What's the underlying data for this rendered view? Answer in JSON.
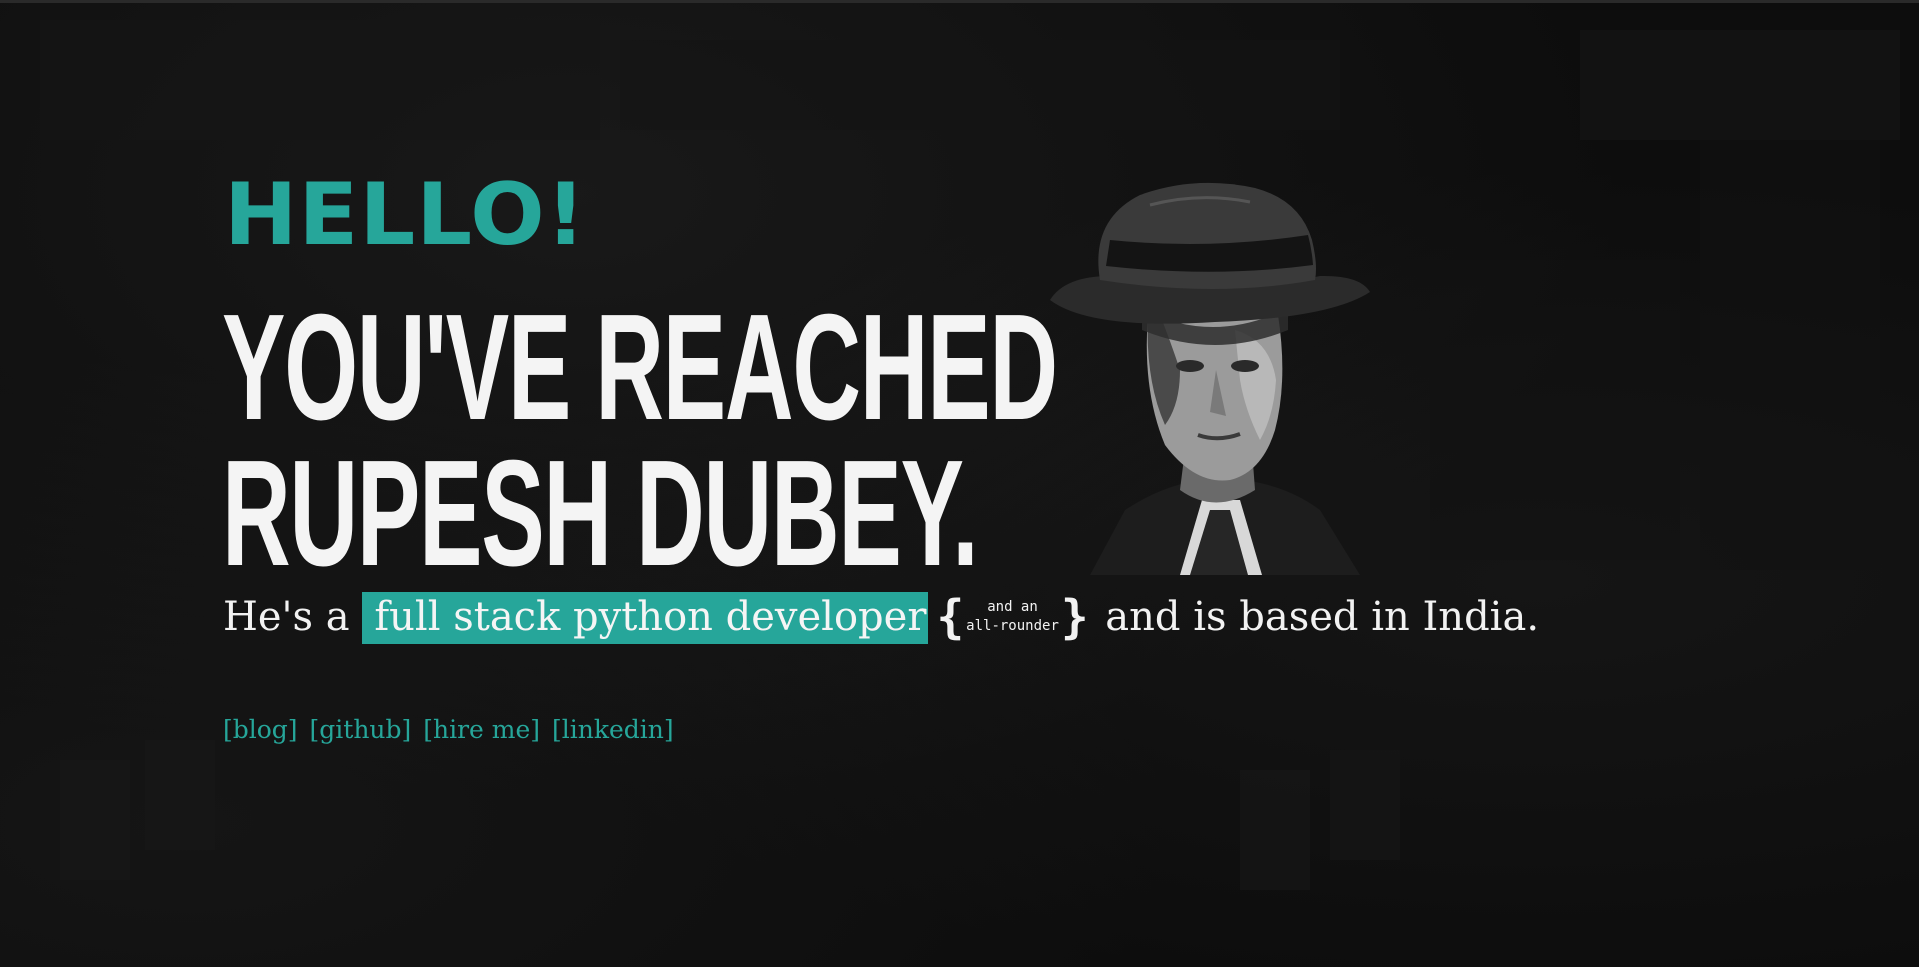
{
  "hero": {
    "greeting": "HELLO!",
    "headline_line1": "YOU'VE REACHED",
    "headline_line2": "RUPESH DUBEY."
  },
  "bio": {
    "prefix": "He's a",
    "role_highlight": "full stack python developer",
    "aside_line1": "and an",
    "aside_line2": "all-rounder",
    "brace_open": "{",
    "brace_close": "}",
    "suffix": "and is based in India."
  },
  "links": [
    {
      "label": "[blog]"
    },
    {
      "label": "[github]"
    },
    {
      "label": "[hire me]"
    },
    {
      "label": "[linkedin]"
    }
  ],
  "colors": {
    "accent": "#26a69a",
    "background": "#0d0d0d",
    "text": "#f2f2f2"
  },
  "icons": {
    "portrait": "man-in-fedora-photo"
  }
}
